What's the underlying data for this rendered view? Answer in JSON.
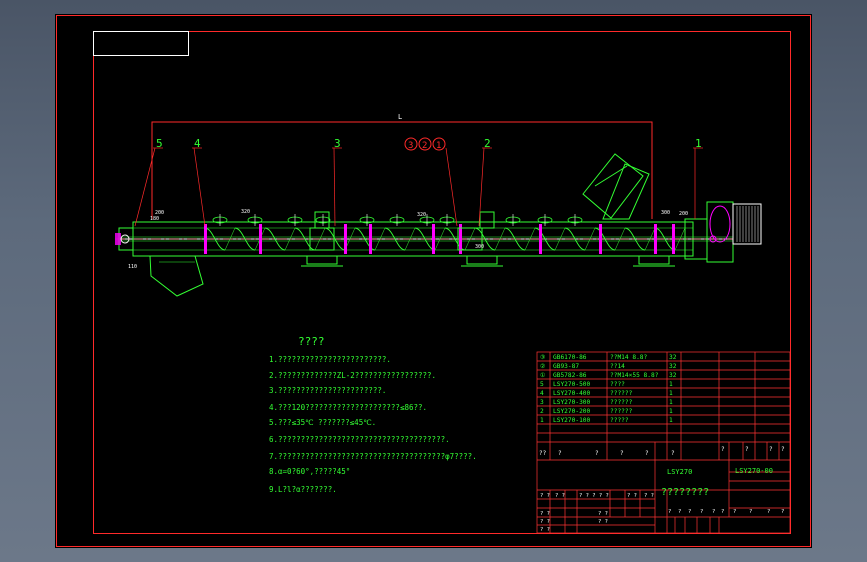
{
  "colors": {
    "background": "#000000",
    "frame": "#ff2a2a",
    "machine": "#33ff33",
    "accent": "#ff00ff",
    "text": "#33ff33",
    "table_lines": "#ff3333",
    "white_text": "#ffffff"
  },
  "drawing": {
    "dimension_label": "L",
    "item_labels": [
      "5",
      "4",
      "3",
      "2",
      "1"
    ],
    "circled_labels": [
      "3",
      "2",
      "1"
    ],
    "small_dims": [
      "180",
      "200",
      "320",
      "320",
      "300",
      "300",
      "200"
    ],
    "left_dim": "110"
  },
  "notes": {
    "title": "????",
    "lines": [
      "1.????????????????????????.",
      "2.?????????????ZL-2?????????????????.",
      "3.???????????????????????.",
      "4.???120?????????????????????≤86??.",
      "5.???≤35℃ ???????≤45℃.",
      "6.?????????????????????????????????????.",
      "7.?????????????????????????????????????φ7????.",
      "8.α=0?60°,?????45°",
      "9.L?l?α???????."
    ]
  },
  "title_block": {
    "parts_list": [
      {
        "no": "③",
        "code": "GB6170-86",
        "name": "??M14 8.8?",
        "qty": "32"
      },
      {
        "no": "②",
        "code": "GB93-87",
        "name": "??14",
        "qty": "32"
      },
      {
        "no": "①",
        "code": "GB5782-86",
        "name": "??M14×55 8.8?",
        "qty": "32"
      },
      {
        "no": "5",
        "code": "LSY270-500",
        "name": "????",
        "qty": "1"
      },
      {
        "no": "4",
        "code": "LSY270-400",
        "name": "??????",
        "qty": "1"
      },
      {
        "no": "3",
        "code": "LSY270-300",
        "name": "??????",
        "qty": "1"
      },
      {
        "no": "2",
        "code": "LSY270-200",
        "name": "??????",
        "qty": "1"
      },
      {
        "no": "1",
        "code": "LSY270-100",
        "name": "?????",
        "qty": "1"
      }
    ],
    "header_marks": [
      "??",
      "?",
      "?",
      "?",
      "?",
      "?"
    ],
    "product_code": "LSY270",
    "drawing_no": "LSY270-00",
    "product_name": "????????",
    "stage_marks": [
      "?",
      "?",
      "?",
      "?"
    ],
    "left_marks": [
      "? ?",
      "? ?",
      "? ?",
      "? ?"
    ],
    "revision_marks": [
      "? ?",
      "? ? ? ? ?",
      "? ?",
      "? ?"
    ],
    "sign_marks": [
      "? ?",
      "? ?"
    ],
    "scale_marks": [
      "?",
      "?",
      "?",
      "?",
      "?",
      "?"
    ],
    "sheet_marks": [
      "?",
      "?",
      "?",
      "?"
    ]
  }
}
